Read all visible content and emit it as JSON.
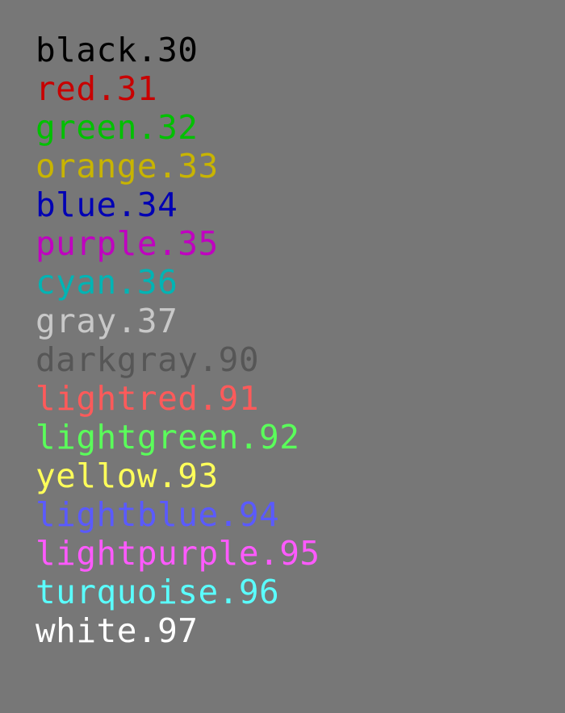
{
  "background_color": "#777777",
  "lines": [
    {
      "text": "black.30",
      "color": "#000000"
    },
    {
      "text": "red.31",
      "color": "#c80000"
    },
    {
      "text": "green.32",
      "color": "#00c000"
    },
    {
      "text": "orange.33",
      "color": "#c8b400"
    },
    {
      "text": "blue.34",
      "color": "#0000b4"
    },
    {
      "text": "purple.35",
      "color": "#c000c0"
    },
    {
      "text": "cyan.36",
      "color": "#00b4b4"
    },
    {
      "text": "gray.37",
      "color": "#c8c8c8"
    },
    {
      "text": "darkgray.90",
      "color": "#565656"
    },
    {
      "text": "lightred.91",
      "color": "#ff5a5a"
    },
    {
      "text": "lightgreen.92",
      "color": "#5aff5a"
    },
    {
      "text": "yellow.93",
      "color": "#ffff5a"
    },
    {
      "text": "lightblue.94",
      "color": "#5a5aff"
    },
    {
      "text": "lightpurple.95",
      "color": "#ff5aff"
    },
    {
      "text": "turquoise.96",
      "color": "#5affff"
    },
    {
      "text": "white.97",
      "color": "#ffffff"
    }
  ]
}
